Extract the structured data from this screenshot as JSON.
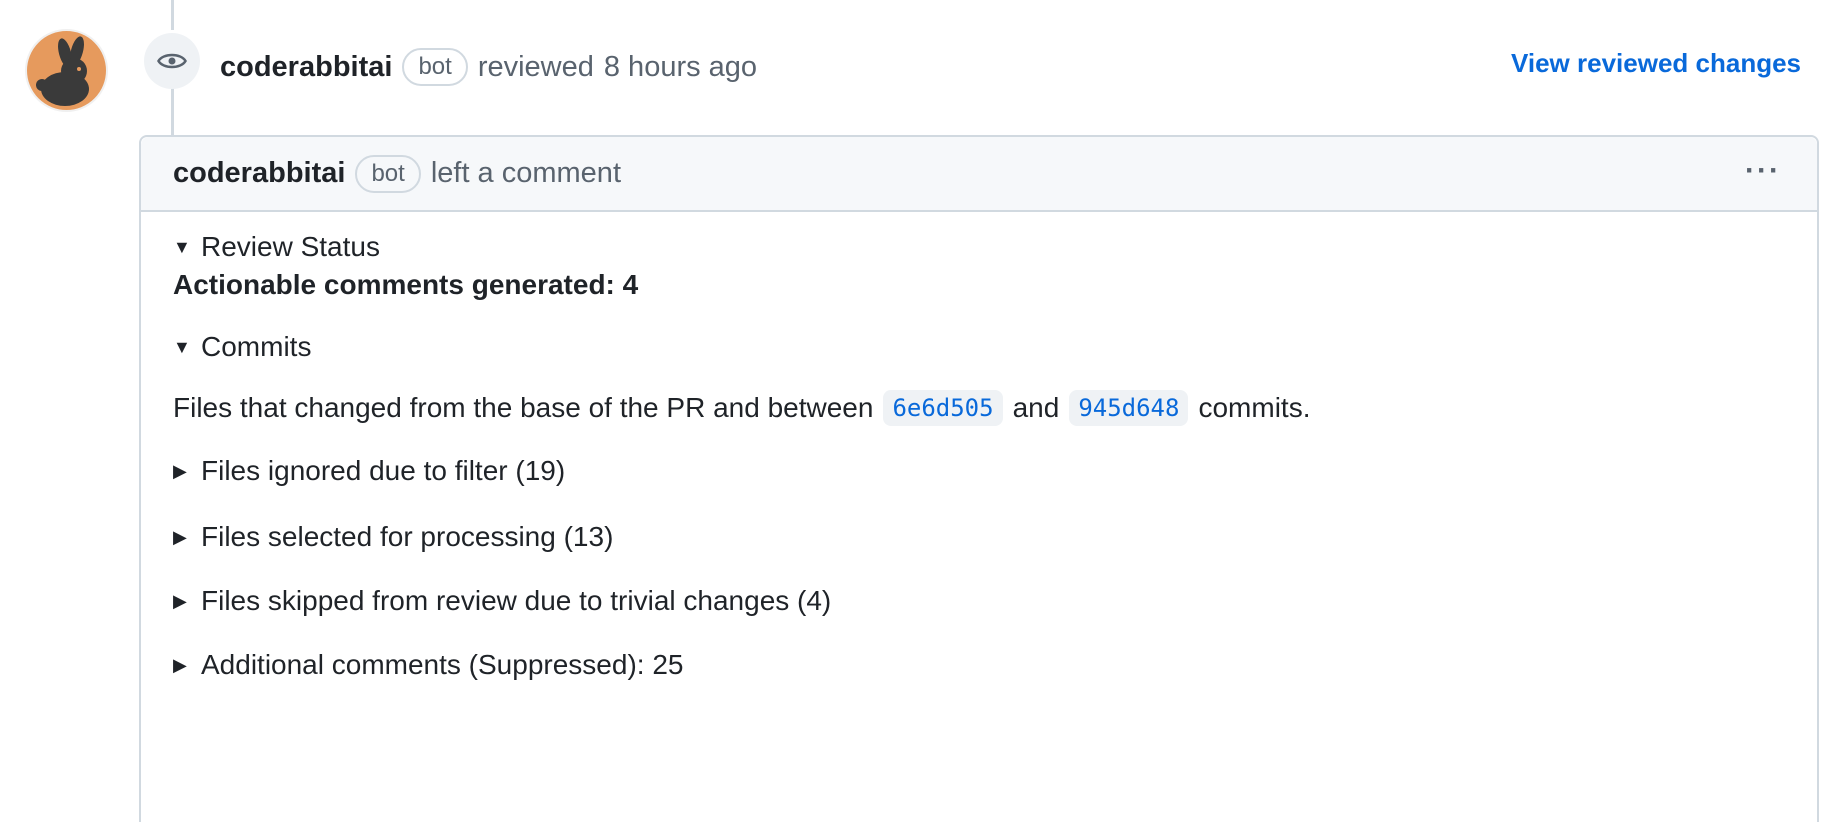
{
  "review": {
    "author": "coderabbitai",
    "badge": "bot",
    "action": "reviewed",
    "time": "8 hours ago",
    "view_link": "View reviewed changes"
  },
  "comment": {
    "author": "coderabbitai",
    "badge": "bot",
    "action": "left a comment",
    "sections": {
      "review_status": "Review Status",
      "actionable": "Actionable comments generated: 4",
      "commits": "Commits",
      "files_text_before": "Files that changed from the base of the PR and between",
      "commit_a": "6e6d505",
      "and_text": "and",
      "commit_b": "945d648",
      "files_text_after": "commits.",
      "ignored": "Files ignored due to filter (19)",
      "selected": "Files selected for processing (13)",
      "skipped": "Files skipped from review due to trivial changes (4)",
      "additional": "Additional comments (Suppressed): 25"
    }
  },
  "icons": {
    "avatar": "rabbit-avatar",
    "event": "eye-icon",
    "menu": "kebab-horizontal-icon",
    "expanded": "triangle-down-icon",
    "collapsed": "triangle-right-icon"
  },
  "colors": {
    "link": "#0969da",
    "avatar_bg": "#e69a5d",
    "border": "#d1d9e0"
  }
}
